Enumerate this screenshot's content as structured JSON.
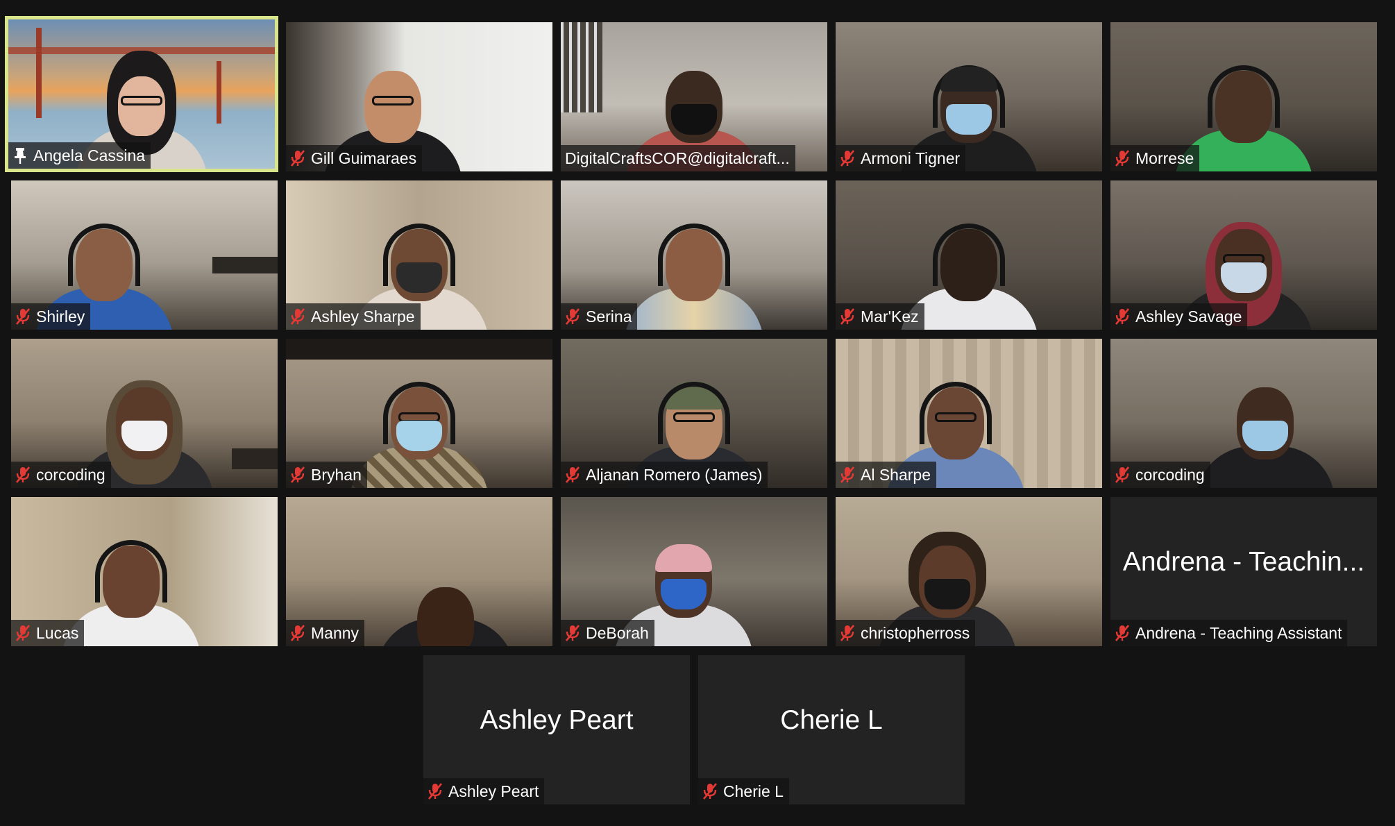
{
  "meeting": {
    "layout": "gallery-view",
    "active_speaker": "Angela Cassina"
  },
  "colors": {
    "background": "#131313",
    "active_speaker_border": "#d9e58a",
    "muted_icon": "#e53935",
    "name_tag_bg": "#121212",
    "no_video_tile": "#232323"
  },
  "participants": [
    {
      "name": "Angela Cassina",
      "icon": "pin-icon",
      "video": true,
      "active": true
    },
    {
      "name": "Gill Guimaraes",
      "icon": "mic-muted-icon",
      "video": true
    },
    {
      "name": "DigitalCraftsCOR@digitalcraft...",
      "icon": "",
      "video": true
    },
    {
      "name": "Armoni Tigner",
      "icon": "mic-muted-icon",
      "video": true
    },
    {
      "name": "Morrese",
      "icon": "mic-muted-icon",
      "video": true
    },
    {
      "name": "Shirley",
      "icon": "mic-muted-icon",
      "video": true
    },
    {
      "name": "Ashley Sharpe",
      "icon": "mic-muted-icon",
      "video": true
    },
    {
      "name": "Serina",
      "icon": "mic-muted-icon",
      "video": true
    },
    {
      "name": "Mar'Kez",
      "icon": "mic-muted-icon",
      "video": true
    },
    {
      "name": "Ashley Savage",
      "icon": "mic-muted-icon",
      "video": true
    },
    {
      "name": "corcoding",
      "icon": "mic-muted-icon",
      "video": true
    },
    {
      "name": "Bryhan",
      "icon": "mic-muted-icon",
      "video": true
    },
    {
      "name": "Aljanan Romero (James)",
      "icon": "mic-muted-icon",
      "video": true
    },
    {
      "name": "Al Sharpe",
      "icon": "mic-muted-icon",
      "video": true
    },
    {
      "name": "corcoding",
      "icon": "mic-muted-icon",
      "video": true
    },
    {
      "name": "Lucas",
      "icon": "mic-muted-icon",
      "video": true
    },
    {
      "name": "Manny",
      "icon": "mic-muted-icon",
      "video": true
    },
    {
      "name": "DeBorah",
      "icon": "mic-muted-icon",
      "video": true
    },
    {
      "name": "christopherross",
      "icon": "mic-muted-icon",
      "video": true
    },
    {
      "name": "Andrena - Teaching Assistant",
      "display_name": "Andrena - Teachin...",
      "icon": "mic-muted-icon",
      "video": false
    },
    {
      "name": "Ashley Peart",
      "display_name": "Ashley Peart",
      "icon": "mic-muted-icon",
      "video": false
    },
    {
      "name": "Cherie L",
      "display_name": "Cherie L",
      "icon": "mic-muted-icon",
      "video": false
    }
  ]
}
